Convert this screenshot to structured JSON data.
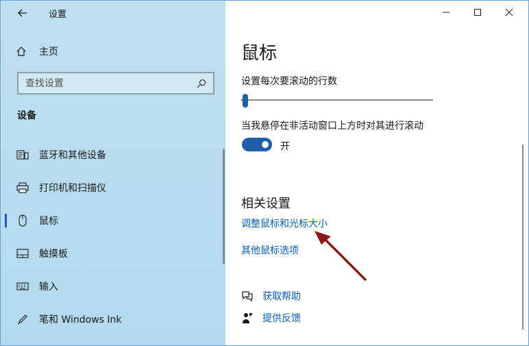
{
  "titlebar": {
    "app_title": "设置",
    "back": "back",
    "minimize": "minimize",
    "maximize": "maximize",
    "close": "close"
  },
  "sidebar": {
    "home_label": "主页",
    "search_placeholder": "查找设置",
    "section_title": "设备",
    "items": [
      {
        "label": "蓝牙和其他设备",
        "icon": "bluetooth-devices-icon"
      },
      {
        "label": "打印机和扫描仪",
        "icon": "printer-icon"
      },
      {
        "label": "鼠标",
        "icon": "mouse-icon",
        "selected": true
      },
      {
        "label": "触摸板",
        "icon": "touchpad-icon"
      },
      {
        "label": "输入",
        "icon": "keyboard-icon"
      },
      {
        "label": "笔和 Windows Ink",
        "icon": "pen-icon"
      }
    ]
  },
  "main": {
    "title": "鼠标",
    "scroll_lines_label": "设置每次要滚动的行数",
    "scroll_lines_value_fraction": 0.02,
    "inactive_scroll_label": "当我悬停在非活动窗口上方时对其进行滚动",
    "toggle_state_label": "开",
    "toggle_on": true,
    "related_title": "相关设置",
    "related_links": [
      "调整鼠标和光标大小",
      "其他鼠标选项"
    ],
    "help_links": [
      {
        "label": "获取帮助",
        "icon": "help-chat-icon"
      },
      {
        "label": "提供反馈",
        "icon": "feedback-icon"
      }
    ]
  },
  "colors": {
    "accent": "#1f5fa8",
    "link": "#0b5fb8",
    "sidebar_bg": "#b7dcef",
    "annotation_arrow": "#8b1a1a"
  }
}
